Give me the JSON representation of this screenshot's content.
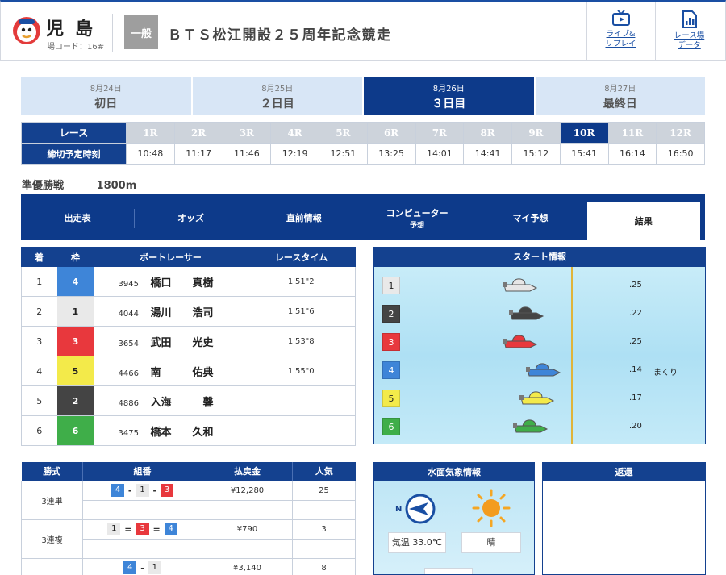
{
  "header": {
    "venue_name": "児島",
    "venue_code": "場コード：16#",
    "grade": "一般",
    "race_title": "ＢＴＳ松江開設２５周年記念競走",
    "live_label1": "ライブ&",
    "live_label2": "リプレイ",
    "result_label1": "レース場",
    "result_label2": "データ"
  },
  "days": [
    {
      "date": "8月24日",
      "name": "初日"
    },
    {
      "date": "8月25日",
      "name": "２日目"
    },
    {
      "date": "8月26日",
      "name": "３日目"
    },
    {
      "date": "8月27日",
      "name": "最終日"
    }
  ],
  "race_table": {
    "race_header": "レース",
    "time_header": "締切予定時刻",
    "races": [
      "1R",
      "2R",
      "3R",
      "4R",
      "5R",
      "6R",
      "7R",
      "8R",
      "9R",
      "10R",
      "11R",
      "12R"
    ],
    "times": [
      "10:48",
      "11:17",
      "11:46",
      "12:19",
      "12:51",
      "13:25",
      "14:01",
      "14:41",
      "15:12",
      "15:41",
      "16:14",
      "16:50"
    ]
  },
  "race_info": {
    "name": "準優勝戦",
    "distance": "1800m"
  },
  "nav": {
    "shussohyo": "出走表",
    "odds": "オッズ",
    "chokuzen": "直前情報",
    "computer": "コンピューター",
    "computer_sub": "予想",
    "my": "マイ予想",
    "kekka": "結果"
  },
  "result": {
    "headers": [
      "着",
      "枠",
      "ボートレーサー",
      "レースタイム"
    ],
    "rows": [
      {
        "rank": "1",
        "waku": "4",
        "id": "3945",
        "name": "橋口　　真樹",
        "time": "1'51\"2"
      },
      {
        "rank": "2",
        "waku": "1",
        "id": "4044",
        "name": "湯川　　浩司",
        "time": "1'51\"6"
      },
      {
        "rank": "3",
        "waku": "3",
        "id": "3654",
        "name": "武田　　光史",
        "time": "1'53\"8"
      },
      {
        "rank": "4",
        "waku": "5",
        "id": "4466",
        "name": "南　　　佑典",
        "time": "1'55\"0"
      },
      {
        "rank": "5",
        "waku": "2",
        "id": "4886",
        "name": "入海　　　馨",
        "time": ""
      },
      {
        "rank": "6",
        "waku": "6",
        "id": "3475",
        "name": "橋本　　久和",
        "time": ""
      }
    ]
  },
  "start": {
    "title": "スタート情報",
    "rows": [
      {
        "waku": "1",
        "st": ".25",
        "tech": "",
        "boat_color": "#e6e6e6",
        "pos": 0.25
      },
      {
        "waku": "2",
        "st": ".22",
        "tech": "",
        "boat_color": "#444444",
        "pos": 0.22
      },
      {
        "waku": "3",
        "st": ".25",
        "tech": "",
        "boat_color": "#e8383d",
        "pos": 0.25
      },
      {
        "waku": "4",
        "st": ".14",
        "tech": "まくり",
        "boat_color": "#3e85d8",
        "pos": 0.14
      },
      {
        "waku": "5",
        "st": ".17",
        "tech": "",
        "boat_color": "#f3ea4a",
        "pos": 0.17
      },
      {
        "waku": "6",
        "st": ".20",
        "tech": "",
        "boat_color": "#3fae49",
        "pos": 0.2
      }
    ]
  },
  "payout": {
    "headers": [
      "勝式",
      "組番",
      "払戻金",
      "人気"
    ],
    "rows": [
      {
        "kind": "3連単",
        "combo": [
          "4",
          "1",
          "3"
        ],
        "sep": [
          "-",
          "-"
        ],
        "amount": "¥12,280",
        "pop": "25"
      },
      {
        "kind": "3連複",
        "combo": [
          "1",
          "3",
          "4"
        ],
        "sep": [
          "=",
          "="
        ],
        "amount": "¥790",
        "pop": "3"
      },
      {
        "kind": "",
        "combo": [
          "4",
          "1"
        ],
        "sep": [
          "-"
        ],
        "amount": "¥3,140",
        "pop": "8"
      }
    ]
  },
  "weather": {
    "title": "水面気象情報",
    "direction": "N",
    "temp_label": "気温",
    "temp_value": "33.0℃",
    "condition": "晴"
  },
  "henkan": {
    "title": "返還"
  },
  "colors": {
    "primary": "#14418f",
    "active": "#0d3a8a",
    "tab_bg": "#d8e6f6"
  }
}
